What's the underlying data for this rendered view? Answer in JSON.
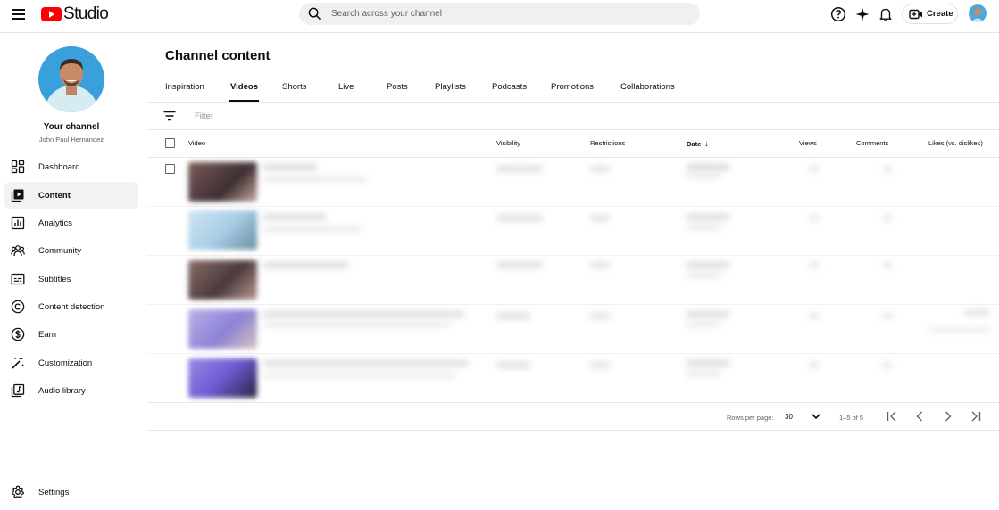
{
  "topbar": {
    "app_name": "Studio",
    "search_placeholder": "Search across your channel",
    "create_label": "Create",
    "brand_color": "#ff0000"
  },
  "sidebar": {
    "channel_title": "Your channel",
    "channel_name": "John Paul Hernandez",
    "items": [
      {
        "label": "Dashboard",
        "icon": "dashboard-icon"
      },
      {
        "label": "Content",
        "icon": "content-icon",
        "active": true
      },
      {
        "label": "Analytics",
        "icon": "analytics-icon"
      },
      {
        "label": "Community",
        "icon": "community-icon"
      },
      {
        "label": "Subtitles",
        "icon": "subtitles-icon"
      },
      {
        "label": "Content detection",
        "icon": "copyright-icon"
      },
      {
        "label": "Earn",
        "icon": "dollar-icon"
      },
      {
        "label": "Customization",
        "icon": "magic-wand-icon"
      },
      {
        "label": "Audio library",
        "icon": "audio-library-icon"
      }
    ],
    "settings_label": "Settings"
  },
  "main": {
    "title": "Channel content",
    "tabs": [
      "Inspiration",
      "Videos",
      "Shorts",
      "Live",
      "Posts",
      "Playlists",
      "Podcasts",
      "Promotions",
      "Collaborations"
    ],
    "active_tab": "Videos",
    "filter_placeholder": "Filter",
    "columns": {
      "video": "Video",
      "visibility": "Visibility",
      "restrictions": "Restrictions",
      "date": "Date",
      "views": "Views",
      "comments": "Comments",
      "likes": "Likes (vs. dislikes)"
    },
    "sort_indicator": "↓"
  },
  "pagination": {
    "rows_per_page_label": "Rows per page:",
    "rows_per_page_value": "30",
    "range": "1–5 of 5"
  }
}
